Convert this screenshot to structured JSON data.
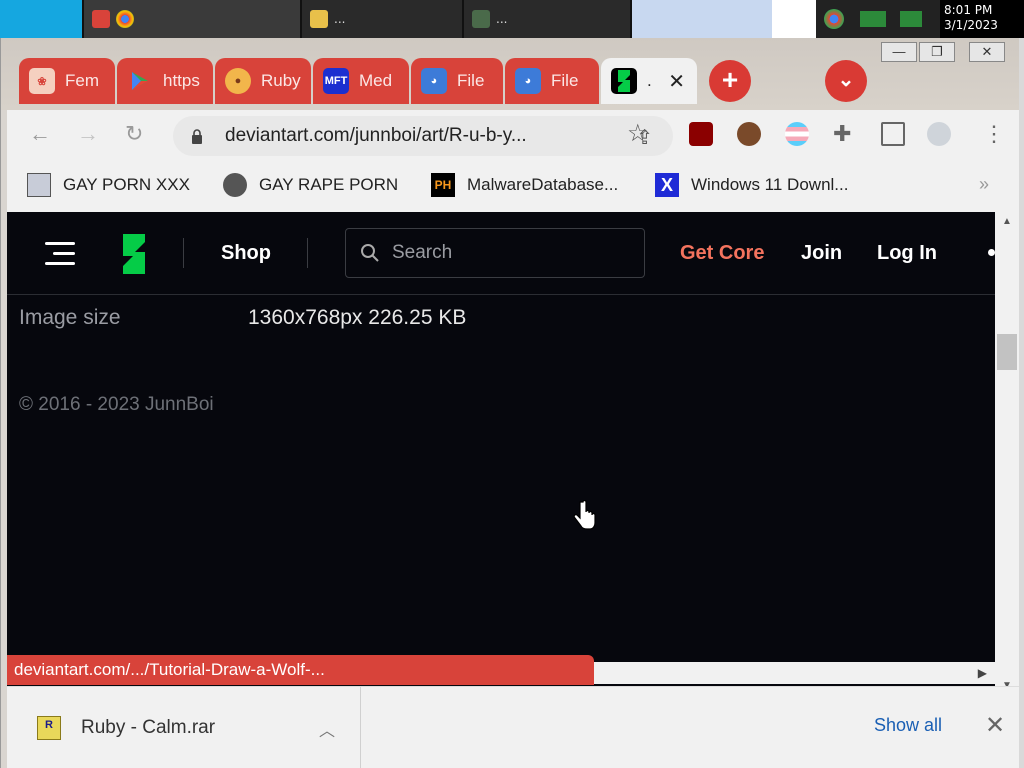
{
  "taskbar": {
    "items": [
      {
        "label": "",
        "icon": "chrome-icon"
      },
      {
        "label": "...",
        "icon": "folder-icon"
      },
      {
        "label": "...",
        "icon": "terminal-icon"
      }
    ],
    "clock_time": "8:01 PM",
    "clock_date": "3/1/2023"
  },
  "window": {
    "minimize": "—",
    "restore": "❐",
    "close": "✕"
  },
  "tabs": [
    {
      "label": "Fem",
      "icon": "shell-icon",
      "color": "#f5d0c0"
    },
    {
      "label": "https",
      "icon": "play-store-icon",
      "color": "#34a853"
    },
    {
      "label": "Ruby",
      "icon": "mushroom-icon",
      "color": "#f2b64b"
    },
    {
      "label": "Med",
      "icon": "mft-icon",
      "color": "#1c2fd0"
    },
    {
      "label": "File",
      "icon": "file-icon",
      "color": "#3d7bd8"
    },
    {
      "label": "File",
      "icon": "file-icon",
      "color": "#3d7bd8"
    },
    {
      "label": ".",
      "icon": "deviantart-icon",
      "color": "#05cc47",
      "active": true
    }
  ],
  "toolbar": {
    "url": "deviantart.com/junnboi/art/R-u-b-y..."
  },
  "bookmarks": [
    {
      "label": "GAY PORN XXX",
      "icon": "computer-icon"
    },
    {
      "label": "GAY RAPE PORN",
      "icon": "globe-icon"
    },
    {
      "label": "MalwareDatabase...",
      "icon": "ph-icon",
      "badge": "PH"
    },
    {
      "label": "Windows 11 Downl...",
      "icon": "x-icon",
      "badge": "X"
    }
  ],
  "header": {
    "shop": "Shop",
    "search_placeholder": "Search",
    "get_core": "Get Core",
    "join": "Join",
    "log_in": "Log In"
  },
  "content": {
    "image_size_label": "Image size",
    "image_size_value": "1360x768px 226.25 KB",
    "copyright": "© 2016 - 2023 JunnBoi"
  },
  "status_url": "deviantart.com/.../Tutorial-Draw-a-Wolf-...",
  "downloads": {
    "file_name": "Ruby - Calm.rar",
    "show_all": "Show all"
  },
  "colors": {
    "tab_accent": "#d8433a",
    "page_bg": "#06070d",
    "get_core": "#f4735e",
    "deviantart_green": "#05cc47"
  }
}
